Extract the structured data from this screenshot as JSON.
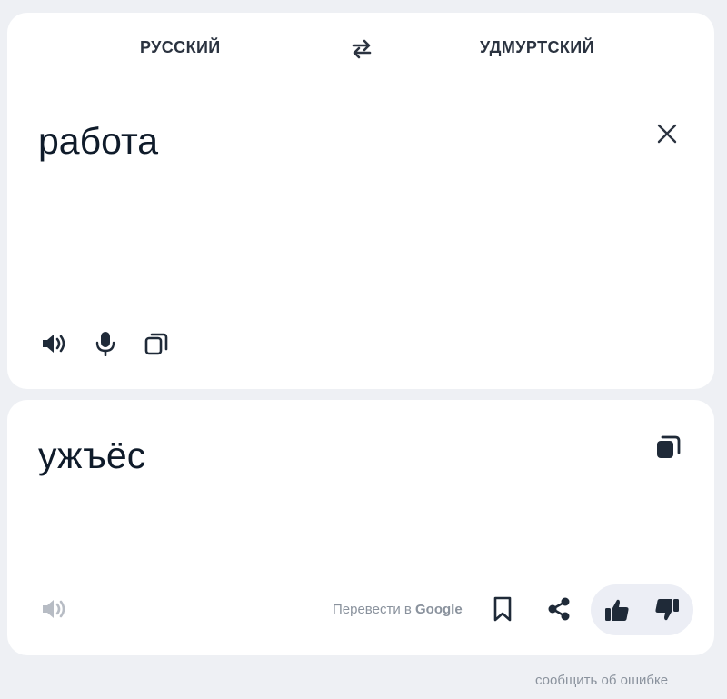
{
  "languages": {
    "source": "РУССКИЙ",
    "target": "УДМУРТСКИЙ"
  },
  "source": {
    "text": "работа"
  },
  "translation": {
    "text": "ужъёс",
    "google_link_prefix": "Перевести в ",
    "google_link_brand": "Google"
  },
  "footer": {
    "report_error": "сообщить об ошибке"
  },
  "icons": {
    "swap": "swap-arrows-icon",
    "clear": "close-icon",
    "speaker": "speaker-icon",
    "mic": "microphone-icon",
    "copy": "copy-icon",
    "bookmark": "bookmark-icon",
    "share": "share-icon",
    "thumb_up": "thumbs-up-icon",
    "thumb_down": "thumbs-down-icon"
  },
  "colors": {
    "background": "#eef0f4",
    "card": "#ffffff",
    "text": "#0f1b2a",
    "muted": "#8a929d",
    "feedback_pill": "#eceef5"
  }
}
